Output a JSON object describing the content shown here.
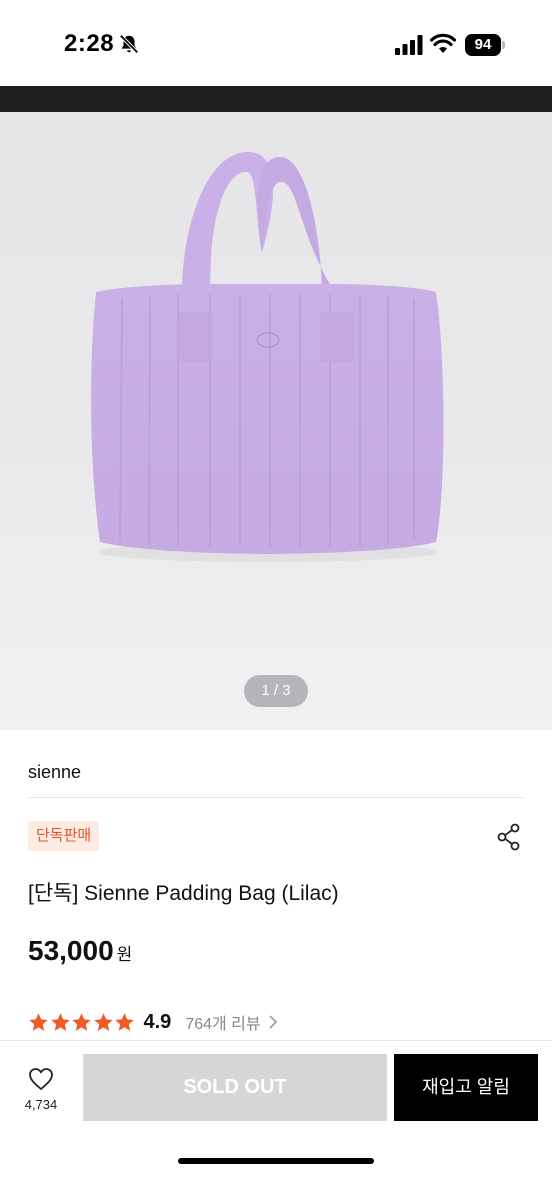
{
  "status_bar": {
    "time": "2:28",
    "battery": "94",
    "icons": [
      "bell-slash-icon",
      "signal-icon",
      "wifi-icon",
      "battery-icon"
    ]
  },
  "gallery": {
    "counter": "1 / 3",
    "product_color": "#cdb5e8"
  },
  "product": {
    "brand": "sienne",
    "badge": "단독판매",
    "title": "[단독] Sienne Padding Bag (Lilac)",
    "price": "53,000",
    "price_unit": "원",
    "rating_stars": 5,
    "rating": "4.9",
    "reviews": "764개 리뷰",
    "share_icon": "share-icon"
  },
  "bottom_bar": {
    "like_count": "4,734",
    "soldout_label": "SOLD OUT",
    "restock_label": "재입고 알림"
  },
  "colors": {
    "accent": "#e8552a",
    "badge_bg": "#fdebe4",
    "star": "#f05a24",
    "soldout_bg": "#d6d6d6"
  }
}
